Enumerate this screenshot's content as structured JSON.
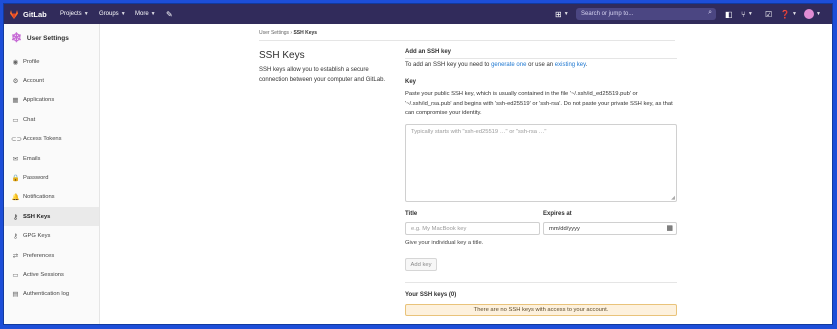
{
  "topbar": {
    "brand": "GitLab",
    "nav": [
      {
        "label": "Projects"
      },
      {
        "label": "Groups"
      },
      {
        "label": "More"
      }
    ],
    "search_placeholder": "Search or jump to..."
  },
  "sidebar": {
    "title": "User Settings",
    "items": [
      {
        "label": "Profile",
        "icon": "profile-icon",
        "glyph": "◉"
      },
      {
        "label": "Account",
        "icon": "account-icon",
        "glyph": "⚙"
      },
      {
        "label": "Applications",
        "icon": "applications-icon",
        "glyph": "▦"
      },
      {
        "label": "Chat",
        "icon": "chat-icon",
        "glyph": "▭"
      },
      {
        "label": "Access Tokens",
        "icon": "token-icon",
        "glyph": "⊂⊃"
      },
      {
        "label": "Emails",
        "icon": "email-icon",
        "glyph": "✉"
      },
      {
        "label": "Password",
        "icon": "lock-icon",
        "glyph": "🔒"
      },
      {
        "label": "Notifications",
        "icon": "bell-icon",
        "glyph": "🔔"
      },
      {
        "label": "SSH Keys",
        "icon": "key-icon",
        "glyph": "⚷"
      },
      {
        "label": "GPG Keys",
        "icon": "gpg-key-icon",
        "glyph": "⚷"
      },
      {
        "label": "Preferences",
        "icon": "preferences-icon",
        "glyph": "⇄"
      },
      {
        "label": "Active Sessions",
        "icon": "sessions-icon",
        "glyph": "▭"
      },
      {
        "label": "Authentication log",
        "icon": "log-icon",
        "glyph": "▤"
      }
    ]
  },
  "breadcrumb": {
    "parent": "User Settings",
    "sep": "›",
    "current": "SSH Keys"
  },
  "page": {
    "title": "SSH Keys",
    "description": "SSH keys allow you to establish a secure connection between your computer and GitLab."
  },
  "form": {
    "heading": "Add an SSH key",
    "intro_before": "To add an SSH key you need to ",
    "intro_link1": "generate one",
    "intro_mid": " or use an ",
    "intro_link2": "existing key",
    "intro_after": ".",
    "key_label": "Key",
    "key_help": "Paste your public SSH key, which is usually contained in the file '~/.ssh/id_ed25519.pub' or '~/.ssh/id_rsa.pub' and begins with 'ssh-ed25519' or 'ssh-rsa'. Do not paste your private SSH key, as that can compromise your identity.",
    "key_placeholder": "Typically starts with \"ssh-ed25519 …\" or \"ssh-rsa …\"",
    "title_label": "Title",
    "title_placeholder": "e.g. My MacBook key",
    "expires_label": "Expires at",
    "expires_value": "mm/dd/yyyy",
    "title_help": "Give your individual key a title.",
    "add_button": "Add key"
  },
  "keys": {
    "heading": "Your SSH keys (0)",
    "empty": "There are no SSH keys with access to your account."
  }
}
